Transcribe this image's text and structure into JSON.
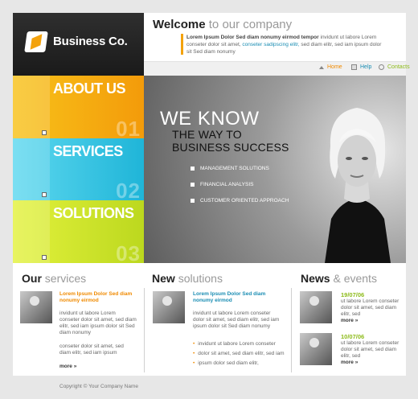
{
  "brand": {
    "name": "Business Co.",
    "accent": "#f3a20d"
  },
  "header": {
    "title_bold": "Welcome",
    "title_light": "to our company",
    "intro_bold": "Lorem Ipsum Dolor Sed diam nonumy eirmod tempor",
    "intro_text_1": " invidunt ut labore Lorem conseter dolor sit amet, ",
    "intro_link": "conseter sadipscing elitr,",
    "intro_text_2": " sed diam  elitr, sed iam ipsum dolor sit Sed diam nonumy"
  },
  "nav": {
    "items": [
      {
        "label": "Home",
        "icon": "home-icon"
      },
      {
        "label": "Help",
        "icon": "help-icon"
      },
      {
        "label": "Contacts",
        "icon": "contacts-icon"
      }
    ]
  },
  "panels": [
    {
      "label": "ABOUT US",
      "number": "01",
      "color": "#f5a712"
    },
    {
      "label": "SERVICES",
      "number": "02",
      "color": "#2ec2e0"
    },
    {
      "label": "SOLUTIONS",
      "number": "03",
      "color": "#c9e02a"
    }
  ],
  "hero": {
    "line1": "WE KNOW",
    "line2": "THE WAY TO",
    "line3": "BUSINESS SUCCESS",
    "items": [
      "MANAGEMENT SOLUTIONS",
      "FINANCIAL ANALYSIS",
      "CUSTOMER ORIENTED APPROACH"
    ]
  },
  "services": {
    "title_bold": "Our",
    "title_light": "services",
    "head": "Lorem Ipsum Dolor Sed diam nonumy eirmod",
    "text1": "invidunt ut labore Lorem conseter dolor sit amet, sed diam  elitr, sed iam ipsum dolor sit Sed diam nonumy",
    "text2": "conseter dolor sit amet, sed diam  elitr, sed iam ipsum",
    "more": "more »"
  },
  "solutions": {
    "title_bold": "New",
    "title_light": "solutions",
    "head": "Lorem Ipsum Dolor Sed diam nonumy eirmod",
    "text": "invidunt ut labore Lorem conseter dolor sit amet, sed diam  elitr, sed iam ipsum dolor sit Sed diam nonumy",
    "items": [
      "invidunt ut labore Lorem conseter",
      "dolor sit amet, sed diam  elitr, sed iam",
      "ipsum dolor sed diam  elitr,"
    ]
  },
  "news": {
    "title_bold": "News",
    "title_light": "& events",
    "items": [
      {
        "date": "19/07/06",
        "text": "ut labore Lorem conseter dolor sit amet, sed diam  elitr, sed",
        "more": "more »"
      },
      {
        "date": "10/07/06",
        "text": "ut labore Lorem conseter dolor sit amet, sed diam  elitr, sed",
        "more": "more »"
      }
    ]
  },
  "footer": {
    "copyright": "Copyright © Your Company Name"
  }
}
